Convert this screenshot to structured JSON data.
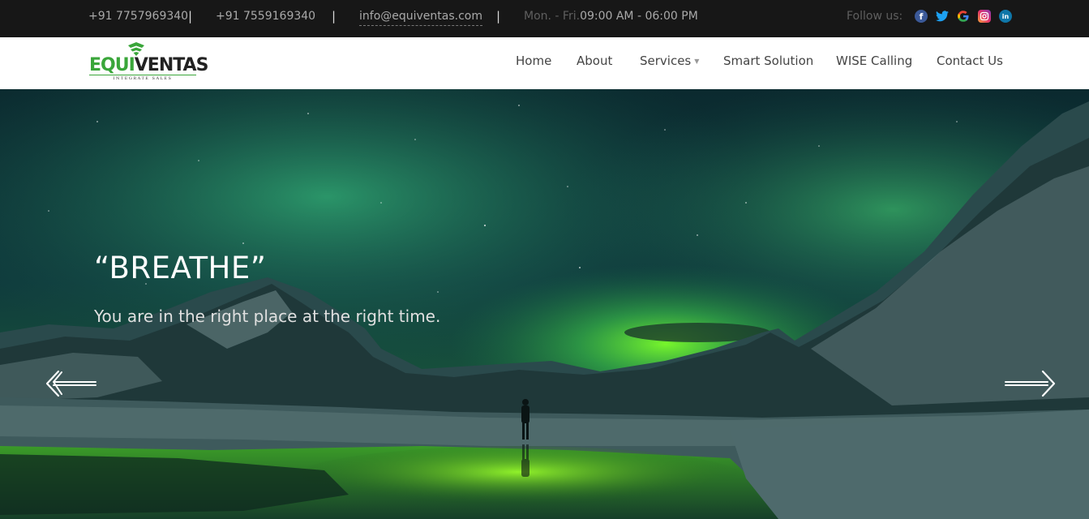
{
  "topbar": {
    "phone1": "+91 7757969340",
    "phone2": "+91 7559169340",
    "separator": "|",
    "email": "info@equiventas.com",
    "hours_label": "Mon. - Fri.",
    "hours_time": "09:00 AM - 06:00 PM",
    "follow_label": "Follow us:",
    "social": [
      {
        "name": "facebook-icon",
        "glyph": "f"
      },
      {
        "name": "twitter-icon",
        "glyph": "t"
      },
      {
        "name": "google-icon",
        "glyph": "G"
      },
      {
        "name": "instagram-icon",
        "glyph": "◎"
      },
      {
        "name": "linkedin-icon",
        "glyph": "in"
      }
    ]
  },
  "brand": {
    "name_green": "EQUI",
    "name_dark": "VENTAS",
    "tagline": "INTEGRATE SALES",
    "accent": "#3aa63a"
  },
  "nav": {
    "home": "Home",
    "about": "About",
    "services": "Services",
    "smart_solution": "Smart Solution",
    "wise_calling": "WISE Calling",
    "contact": "Contact Us"
  },
  "hero": {
    "title": "“BREATHE”",
    "subtitle": "You are in the right place at the right time.",
    "prev_icon": "arrow-left-icon",
    "next_icon": "arrow-right-icon"
  }
}
